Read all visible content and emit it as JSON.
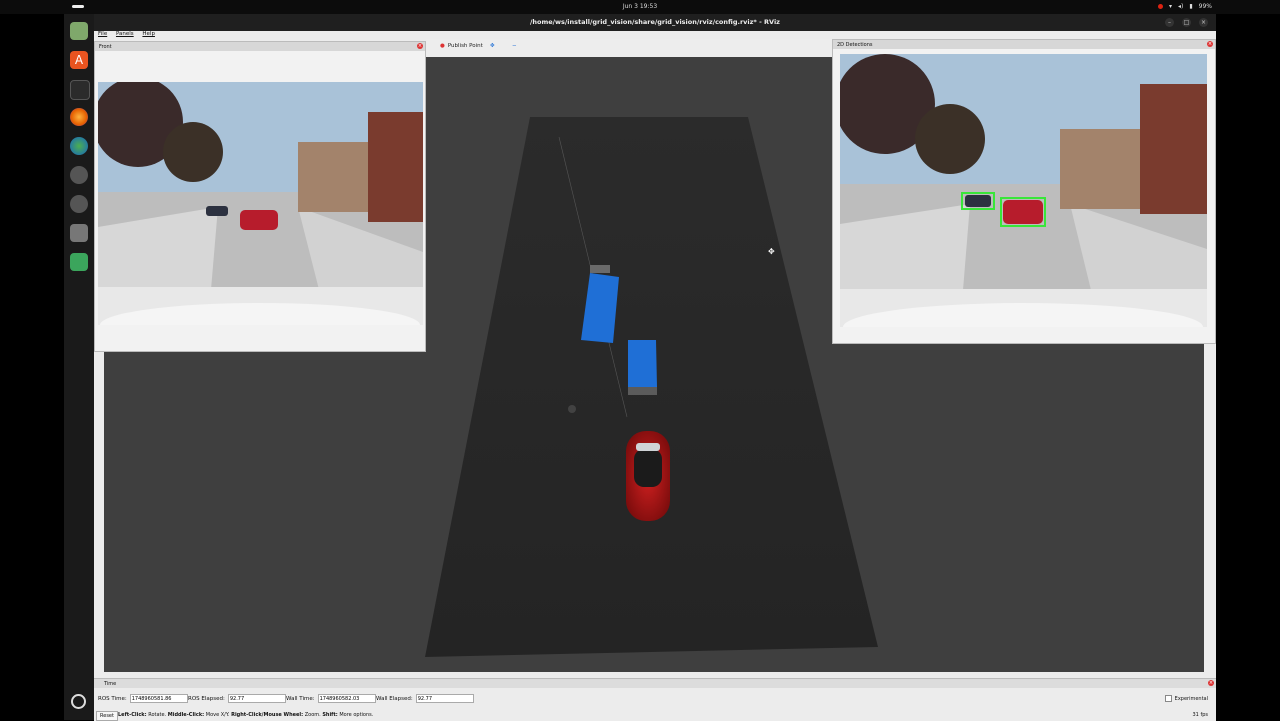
{
  "topbar": {
    "clock": "Jun 3  19:53",
    "battery": "99%"
  },
  "window": {
    "title": "/home/ws/install/grid_vision/share/grid_vision/rviz/config.rviz* - RViz"
  },
  "menu": {
    "file": "File",
    "panels": "Panels",
    "help": "Help"
  },
  "toolbar": {
    "publish_point": "Publish Point"
  },
  "panels": {
    "front": {
      "title": "Front"
    },
    "detections": {
      "title": "2D Detections"
    },
    "time": {
      "title": "Time"
    }
  },
  "time": {
    "ros_time_label": "ROS Time:",
    "ros_time": "1748960581.86",
    "ros_elapsed_label": "ROS Elapsed:",
    "ros_elapsed": "92.77",
    "wall_time_label": "Wall Time:",
    "wall_time": "1748960582.03",
    "wall_elapsed_label": "Wall Elapsed:",
    "wall_elapsed": "92.77",
    "experimental": "Experimental"
  },
  "status": {
    "reset": "Reset",
    "hint_b1": "Left-Click:",
    "hint_t1": " Rotate. ",
    "hint_b2": "Middle-Click:",
    "hint_t2": " Move X/Y. ",
    "hint_b3": "Right-Click/Mouse Wheel:",
    "hint_t3": " Zoom. ",
    "hint_b4": "Shift:",
    "hint_t4": " More options.",
    "fps": "31 fps"
  },
  "colors": {
    "box_blue": "#1f6fd6",
    "car_red": "#b01818",
    "detection_green": "#39e639"
  }
}
